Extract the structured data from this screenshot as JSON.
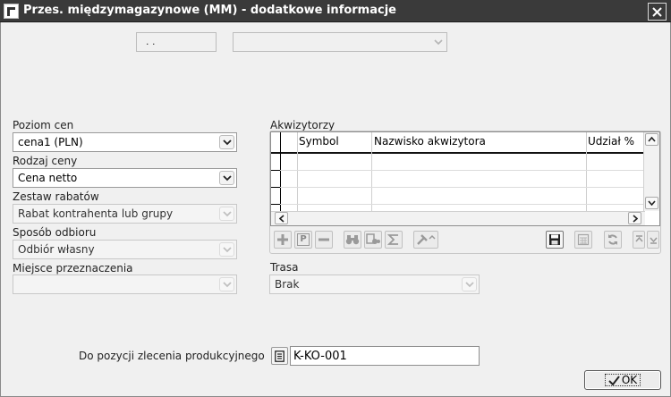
{
  "window": {
    "title": "Przes. międzymagazynowe (MM) - dodatkowe informacje"
  },
  "top": {
    "date_value": ". .",
    "combo_value": ""
  },
  "left": {
    "price_level": {
      "label": "Poziom cen",
      "value": "cena1 (PLN)"
    },
    "price_type": {
      "label": "Rodzaj ceny",
      "value": "Cena netto"
    },
    "discount_set": {
      "label": "Zestaw rabatów",
      "value": "Rabat kontrahenta lub grupy"
    },
    "pickup": {
      "label": "Sposób odbioru",
      "value": "Odbiór własny"
    },
    "destination": {
      "label": "Miejsce przeznaczenia",
      "value": ""
    }
  },
  "acquirers": {
    "label": "Akwizytorzy",
    "columns": [
      "Symbol",
      "Nazwisko akwizytora",
      "Udział %"
    ],
    "rows": []
  },
  "toolbar": {
    "add_icon": "plus-icon",
    "p_icon": "p-icon",
    "remove_icon": "minus-icon",
    "find_icon": "binoculars-icon",
    "filter_icon": "filter-icon",
    "sum_icon": "sigma-icon",
    "tools_icon": "tools-icon",
    "save_icon": "floppy-icon",
    "calc_icon": "calculator-icon",
    "refresh_icon": "refresh-icon",
    "moveup_icon": "move-up-icon",
    "movedown_icon": "move-down-icon"
  },
  "route": {
    "label": "Trasa",
    "value": "Brak"
  },
  "production_order": {
    "label": "Do pozycji zlecenia produkcyjnego",
    "value": "K-KO-001"
  },
  "ok": {
    "label": "OK"
  },
  "colors": {
    "titlebar": "#3a3a3a",
    "background": "#f0f0f0"
  }
}
